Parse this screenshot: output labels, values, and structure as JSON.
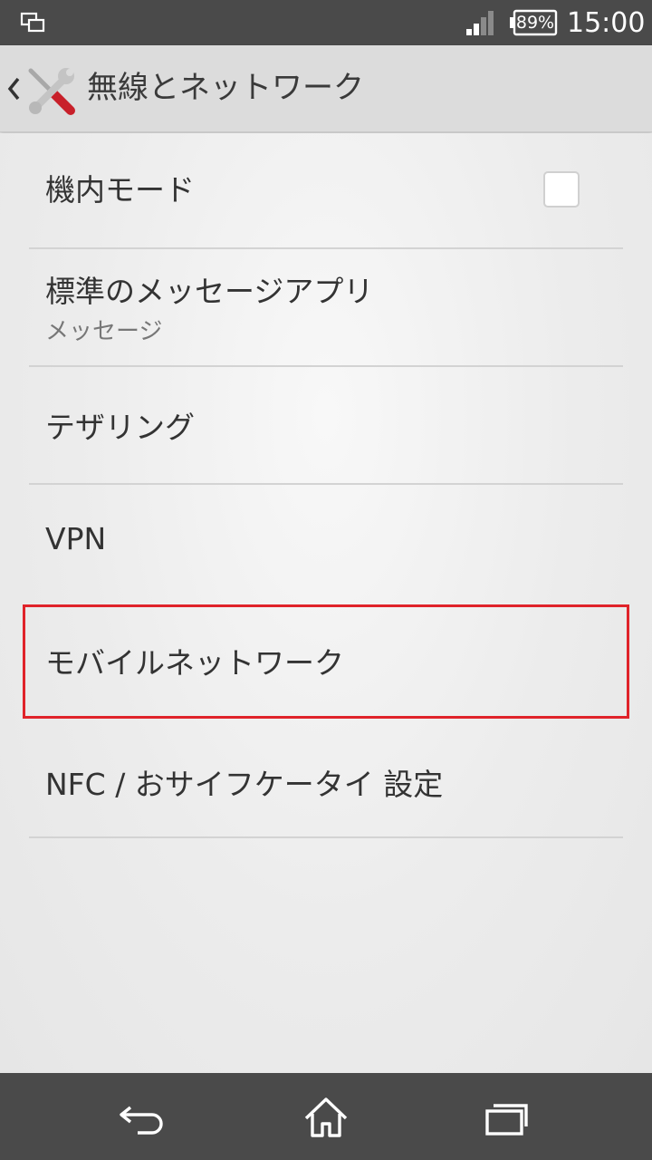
{
  "status_bar": {
    "battery_level": "89%",
    "time": "15:00",
    "icons": [
      "screen-mirror-icon",
      "signal-icon",
      "battery-icon"
    ]
  },
  "action_bar": {
    "title": "無線とネットワーク",
    "icons": [
      "back-caret-icon",
      "tools-icon"
    ]
  },
  "settings": {
    "items": [
      {
        "title": "機内モード",
        "subtitle": "",
        "control": "checkbox",
        "checked": false
      },
      {
        "title": "標準のメッセージアプリ",
        "subtitle": "メッセージ"
      },
      {
        "title": "テザリング",
        "subtitle": ""
      },
      {
        "title": "VPN",
        "subtitle": ""
      },
      {
        "title": "モバイルネットワーク",
        "subtitle": "",
        "highlighted": true
      },
      {
        "title": "NFC / おサイフケータイ 設定",
        "subtitle": ""
      }
    ]
  },
  "colors": {
    "status_bar_bg": "#4a4a4a",
    "action_bar_bg": "#dcdcdc",
    "highlight_border": "#e0232a",
    "tools_handle_red": "#c8202a"
  },
  "nav_bar": {
    "icons": [
      "back-icon",
      "home-icon",
      "recent-apps-icon"
    ]
  }
}
